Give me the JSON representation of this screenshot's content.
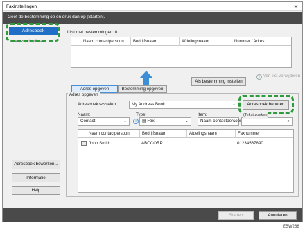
{
  "window": {
    "title": "Faxinstellingen",
    "close_glyph": "✕"
  },
  "instruction": "Geef de bestemming op en druk dan op [Starten].",
  "sidebar": {
    "active_item": "Adresboek",
    "second_item": "Verzendopties",
    "buttons": [
      "Adresboek bewerken...",
      "Informatie",
      "Help"
    ]
  },
  "destinations": {
    "label": "Lijst met bestemmingen: 0",
    "columns": [
      "Naam contactpersoon",
      "Bedrijfsnaam",
      "Afdelingsnaam",
      "Nummer / Adres"
    ]
  },
  "add_destination_button": "Als bestemming instellen",
  "remove_from_list_button": "Van lijst verwijderen",
  "tabs": [
    "Adres opgeven",
    "Bestemming opgeven"
  ],
  "address_section": {
    "label": "Adres opgeven",
    "switch_label": "Adresboek wisselen:",
    "switch_value": "My Address Book",
    "manage_button": "Adresboek beheren",
    "name_label": "Naam:",
    "name_value": "Contact",
    "type_label": "Type:",
    "type_value": "Fax",
    "item_label": "Item:",
    "item_value": "Naam contactpersoon",
    "search_placeholder": "(Tekst zoeken)"
  },
  "contacts": {
    "columns": [
      "Naam contactpersoon",
      "Bedrijfsnaam",
      "Afdelingsnaam",
      "Faxnummer"
    ],
    "rows": [
      {
        "name": "John Smith",
        "company": "ABCCORP",
        "department": "",
        "fax": "01234567890"
      }
    ]
  },
  "footer": {
    "start_button": "Starten",
    "cancel_button": "Annuleren"
  },
  "figure_code": "EBW288",
  "colors": {
    "accent": "#1f6fc7",
    "highlight_dash": "#2e9a3c",
    "arrow": "#3c8fd6",
    "band": "#4a4a4a"
  },
  "icons": {
    "close": "close-icon",
    "arrow": "arrow-up-icon",
    "info": "info-icon",
    "fax": "fax-icon",
    "contact": "contact-card-icon",
    "search": "search-icon"
  }
}
